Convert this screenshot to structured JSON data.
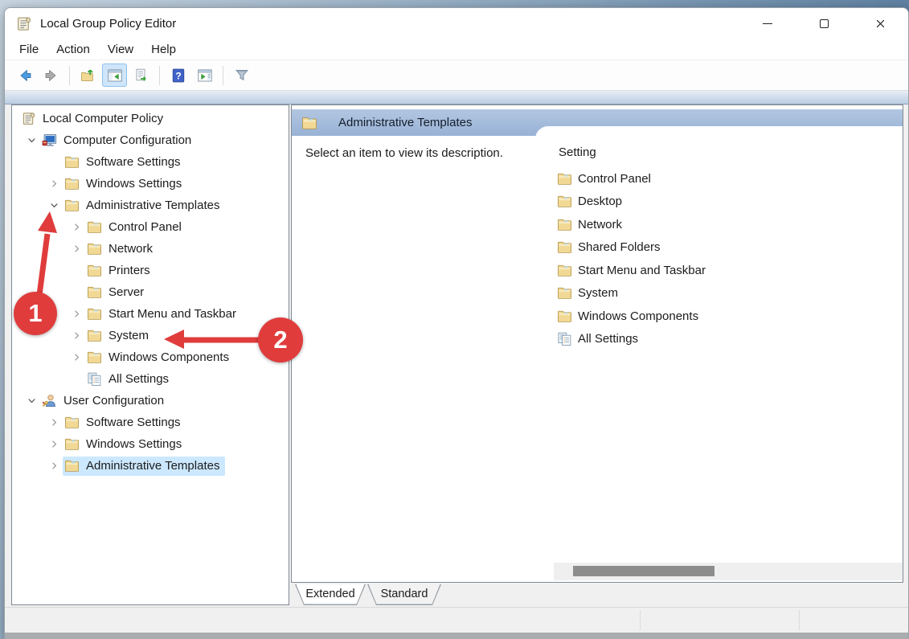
{
  "window": {
    "title": "Local Group Policy Editor"
  },
  "titlebar": {
    "controls": [
      "minimize",
      "maximize",
      "close"
    ]
  },
  "menubar": {
    "items": [
      "File",
      "Action",
      "View",
      "Help"
    ]
  },
  "toolbar": {
    "items": [
      {
        "type": "button",
        "name": "back",
        "icon": "back"
      },
      {
        "type": "button",
        "name": "forward",
        "icon": "forward"
      },
      {
        "type": "separator"
      },
      {
        "type": "button",
        "name": "up-one-level",
        "icon": "up-folder"
      },
      {
        "type": "button",
        "name": "show-console-tree",
        "icon": "console-tree",
        "active": true
      },
      {
        "type": "button",
        "name": "export-list",
        "icon": "export"
      },
      {
        "type": "separator"
      },
      {
        "type": "button",
        "name": "help",
        "icon": "help"
      },
      {
        "type": "button",
        "name": "show-action-pane",
        "icon": "action-pane"
      },
      {
        "type": "separator"
      },
      {
        "type": "button",
        "name": "filter",
        "icon": "filter"
      }
    ]
  },
  "tree": {
    "items": [
      {
        "label": "Local Computer Policy",
        "depth": 0,
        "icon": "scroll",
        "chevron": null,
        "selected": false
      },
      {
        "label": "Computer Configuration",
        "depth": 1,
        "icon": "computer",
        "chevron": "expanded",
        "selected": false
      },
      {
        "label": "Software Settings",
        "depth": 2,
        "icon": "folder",
        "chevron": null,
        "selected": false
      },
      {
        "label": "Windows Settings",
        "depth": 2,
        "icon": "folder",
        "chevron": "collapsed",
        "selected": false
      },
      {
        "label": "Administrative Templates",
        "depth": 2,
        "icon": "folder",
        "chevron": "expanded",
        "selected": false
      },
      {
        "label": "Control Panel",
        "depth": 3,
        "icon": "folder",
        "chevron": "collapsed",
        "selected": false
      },
      {
        "label": "Network",
        "depth": 3,
        "icon": "folder",
        "chevron": "collapsed",
        "selected": false
      },
      {
        "label": "Printers",
        "depth": 3,
        "icon": "folder",
        "chevron": null,
        "selected": false
      },
      {
        "label": "Server",
        "depth": 3,
        "icon": "folder",
        "chevron": null,
        "selected": false
      },
      {
        "label": "Start Menu and Taskbar",
        "depth": 3,
        "icon": "folder",
        "chevron": "collapsed",
        "selected": false
      },
      {
        "label": "System",
        "depth": 3,
        "icon": "folder",
        "chevron": "collapsed",
        "selected": false
      },
      {
        "label": "Windows Components",
        "depth": 3,
        "icon": "folder",
        "chevron": "collapsed",
        "selected": false
      },
      {
        "label": "All Settings",
        "depth": 3,
        "icon": "pages",
        "chevron": null,
        "selected": false
      },
      {
        "label": "User Configuration",
        "depth": 1,
        "icon": "user",
        "chevron": "expanded",
        "selected": false
      },
      {
        "label": "Software Settings",
        "depth": 2,
        "icon": "folder",
        "chevron": "collapsed",
        "selected": false
      },
      {
        "label": "Windows Settings",
        "depth": 2,
        "icon": "folder",
        "chevron": "collapsed",
        "selected": false
      },
      {
        "label": "Administrative Templates",
        "depth": 2,
        "icon": "folder",
        "chevron": "collapsed",
        "selected": true
      }
    ]
  },
  "main": {
    "header": {
      "title": "Administrative Templates",
      "icon": "folder"
    },
    "description": "Select an item to view its description.",
    "settings": {
      "column_header": "Setting",
      "items": [
        {
          "label": "Control Panel",
          "icon": "folder"
        },
        {
          "label": "Desktop",
          "icon": "folder"
        },
        {
          "label": "Network",
          "icon": "folder"
        },
        {
          "label": "Shared Folders",
          "icon": "folder"
        },
        {
          "label": "Start Menu and Taskbar",
          "icon": "folder"
        },
        {
          "label": "System",
          "icon": "folder"
        },
        {
          "label": "Windows Components",
          "icon": "folder"
        },
        {
          "label": "All Settings",
          "icon": "pages"
        }
      ]
    },
    "tabs": [
      {
        "label": "Extended",
        "active": true
      },
      {
        "label": "Standard",
        "active": false
      }
    ]
  },
  "annotations": {
    "steps": [
      {
        "label": "1"
      },
      {
        "label": "2"
      }
    ]
  },
  "colors": {
    "annotation": "#e03c3c",
    "selection": "#cce8ff",
    "header_bar_top": "#b2c6e1",
    "header_bar_bottom": "#98b2d5",
    "toolbar_highlight": "#cfe6fa",
    "toolbar_highlight_border": "#8ec1ee"
  }
}
